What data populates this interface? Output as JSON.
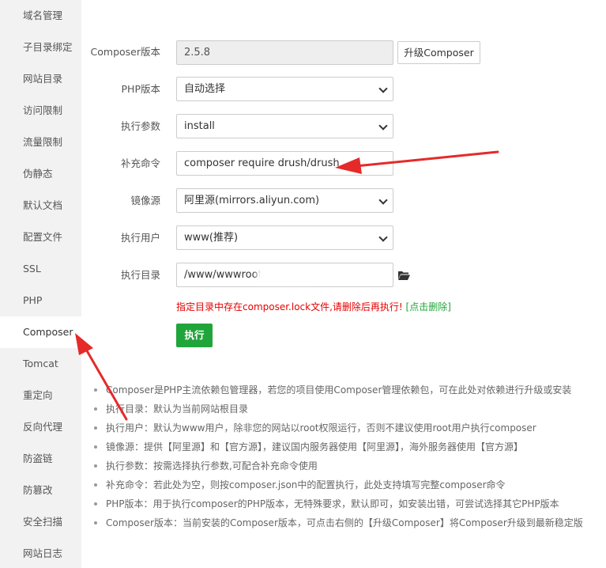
{
  "sidebar": {
    "items": [
      {
        "label": "域名管理",
        "icon": "none"
      },
      {
        "label": "子目录绑定"
      },
      {
        "label": "网站目录"
      },
      {
        "label": "访问限制"
      },
      {
        "label": "流量限制"
      },
      {
        "label": "伪静态"
      },
      {
        "label": "默认文档"
      },
      {
        "label": "配置文件"
      },
      {
        "label": "SSL"
      },
      {
        "label": "PHP"
      },
      {
        "label": "Composer",
        "active": true
      },
      {
        "label": "Tomcat"
      },
      {
        "label": "重定向"
      },
      {
        "label": "反向代理"
      },
      {
        "label": "防盗链"
      },
      {
        "label": "防篡改"
      },
      {
        "label": "安全扫描"
      },
      {
        "label": "网站日志"
      }
    ]
  },
  "form": {
    "composer_version": {
      "label": "Composer版本",
      "value": "2.5.8"
    },
    "upgrade_button": "升级Composer",
    "php_version": {
      "label": "PHP版本",
      "value": "自动选择"
    },
    "exec_params": {
      "label": "执行参数",
      "value": "install"
    },
    "extra_command": {
      "label": "补充命令",
      "value": "composer require drush/drush"
    },
    "mirror": {
      "label": "镜像源",
      "value": "阿里源(mirrors.aliyun.com)"
    },
    "exec_user": {
      "label": "执行用户",
      "value": "www(推荐)"
    },
    "exec_dir": {
      "label": "执行目录",
      "value": "/www/wwwroot"
    },
    "warning_text": "指定目录中存在composer.lock文件,请删除后再执行!",
    "warning_link": "[点击删除]",
    "execute_button": "执行"
  },
  "help": [
    "Composer是PHP主流依赖包管理器，若您的项目使用Composer管理依赖包，可在此处对依赖进行升级或安装",
    "执行目录：默认为当前网站根目录",
    "执行用户：默认为www用户，除非您的网站以root权限运行，否则不建议使用root用户执行composer",
    "镜像源：提供【阿里源】和【官方源】，建议国内服务器使用【阿里源】，海外服务器使用【官方源】",
    "执行参数：按需选择执行参数,可配合补充命令使用",
    "补充命令：若此处为空，则按composer.json中的配置执行，此处支持填写完整composer命令",
    "PHP版本：用于执行composer的PHP版本，无特殊要求，默认即可，如安装出错，可尝试选择其它PHP版本",
    "Composer版本：当前安装的Composer版本，可点击右侧的【升级Composer】将Composer升级到最新稳定版"
  ],
  "icons": {
    "folder": "folder-open-icon",
    "annotation": "red-arrow-annotation"
  },
  "colors": {
    "accent_green": "#20a53a",
    "warning_red": "#e60000",
    "arrow_red": "#e52a2a"
  }
}
